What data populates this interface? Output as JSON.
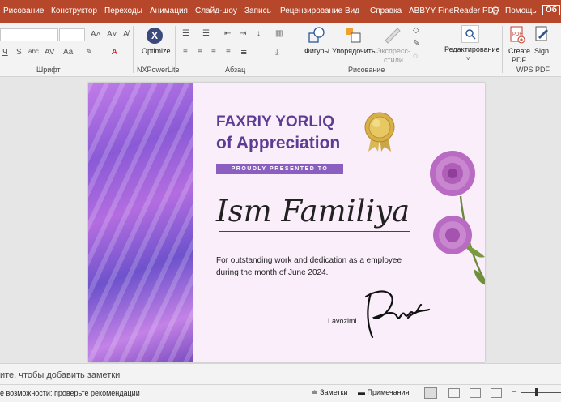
{
  "ribbon_tabs": [
    "Рисование",
    "Конструктор",
    "Переходы",
    "Анимация",
    "Слайд-шоу",
    "Запись",
    "Рецензирование",
    "Вид",
    "Справка",
    "ABBYY FineReader PDF",
    "Помощь",
    "Об"
  ],
  "groups": {
    "font": "Шрифт",
    "nxpowerlite": "NXPowerLite",
    "paragraph": "Абзац",
    "drawing": "Рисование",
    "wps": "WPS PDF"
  },
  "buttons": {
    "optimize": "Optimize",
    "shapes": "Фигуры",
    "arrange": "Упорядочить",
    "express_styles": "Экспресс-стили",
    "editing": "Редактирование",
    "create_pdf_1": "Create",
    "create_pdf_2": "PDF",
    "sign": "Sign"
  },
  "slide": {
    "title_line1": "FAXRIY YORLIQ",
    "title_line2": "of Appreciation",
    "presented": "PROUDLY PRESENTED TO",
    "name": "Ism Familiya",
    "description_line1": "For outstanding work and dedication as a employee",
    "description_line2": "during the month of June 2024.",
    "position_label": "Lavozimi"
  },
  "notes": {
    "placeholder": "ите, чтобы добавить заметки"
  },
  "status": {
    "accessibility": "е возможности: проверьте рекомендации",
    "notes": "Заметки",
    "comments": "Примечания"
  },
  "colors": {
    "accent": "#b7472a",
    "title": "#5d3d94",
    "banner": "#8b5fc0"
  }
}
